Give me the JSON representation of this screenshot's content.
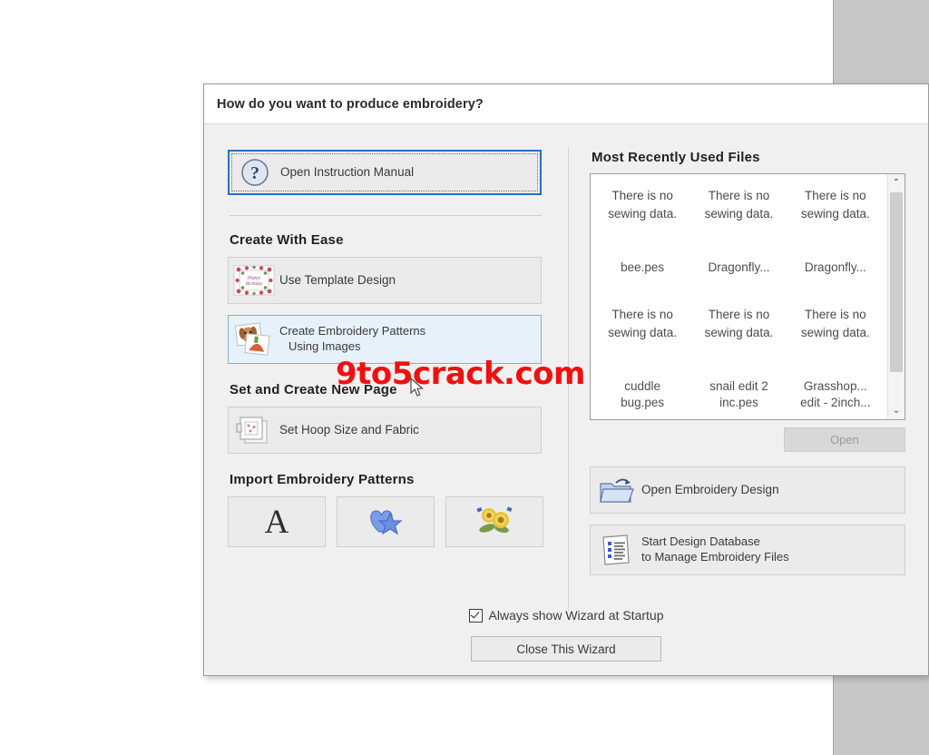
{
  "dialog": {
    "title": "How do you want to produce embroidery?"
  },
  "left": {
    "manual_button": {
      "label": "Open Instruction Manual",
      "icon": "question-mark-icon"
    },
    "create_with_ease": {
      "heading": "Create With Ease",
      "template_button": {
        "label": "Use Template Design",
        "icon": "template-design-icon"
      },
      "photo_button": {
        "label_line1": "Create Embroidery Patterns",
        "label_line2": "Using Images",
        "icon": "photo-stack-icon"
      }
    },
    "new_page": {
      "heading": "Set and Create New Page",
      "hoop_button": {
        "label": "Set Hoop Size and Fabric",
        "icon": "hoop-fabric-icon"
      }
    },
    "import": {
      "heading": "Import Embroidery Patterns",
      "buttons": [
        {
          "name": "text-import",
          "icon": "letter-a-icon",
          "glyph": "A"
        },
        {
          "name": "shape-import",
          "icon": "heart-star-icon"
        },
        {
          "name": "photo-import",
          "icon": "sunflower-icon"
        }
      ]
    }
  },
  "right": {
    "mru_heading": "Most Recently Used Files",
    "mru_files": [
      {
        "preview": "There is\nno sewing\ndata.",
        "name": "bee.pes"
      },
      {
        "preview": "There is\nno sewing\ndata.",
        "name": "Dragonfly..."
      },
      {
        "preview": "There is\nno sewing\ndata.",
        "name": "Dragonfly..."
      },
      {
        "preview": "There is\nno sewing\ndata.",
        "name": "cuddle\nbug.pes"
      },
      {
        "preview": "There is\nno sewing\ndata.",
        "name": "snail edit 2\ninc.pes"
      },
      {
        "preview": "There is\nno sewing\ndata.",
        "name": "Grasshop...\nedit - 2inch..."
      }
    ],
    "scrollbar": {
      "up_arrow": "⌃",
      "down_arrow": "⌄"
    },
    "open_button": {
      "label": "Open",
      "enabled": false
    },
    "open_design_button": {
      "label": "Open Embroidery Design",
      "icon": "open-folder-icon"
    },
    "design_database_button": {
      "label_line1": "Start Design Database",
      "label_line2": "to Manage Embroidery Files",
      "icon": "database-list-icon"
    }
  },
  "footer": {
    "checkbox_label": "Always show Wizard at Startup",
    "checkbox_checked": true,
    "close_button": "Close This Wizard"
  },
  "overlay": {
    "watermark": "9to5crack.com"
  },
  "colors": {
    "accent_blue": "#2a70c0",
    "selected_bg": "#e6f1fa",
    "dialog_bg": "#f0f0f0",
    "watermark_red": "#f01010"
  }
}
